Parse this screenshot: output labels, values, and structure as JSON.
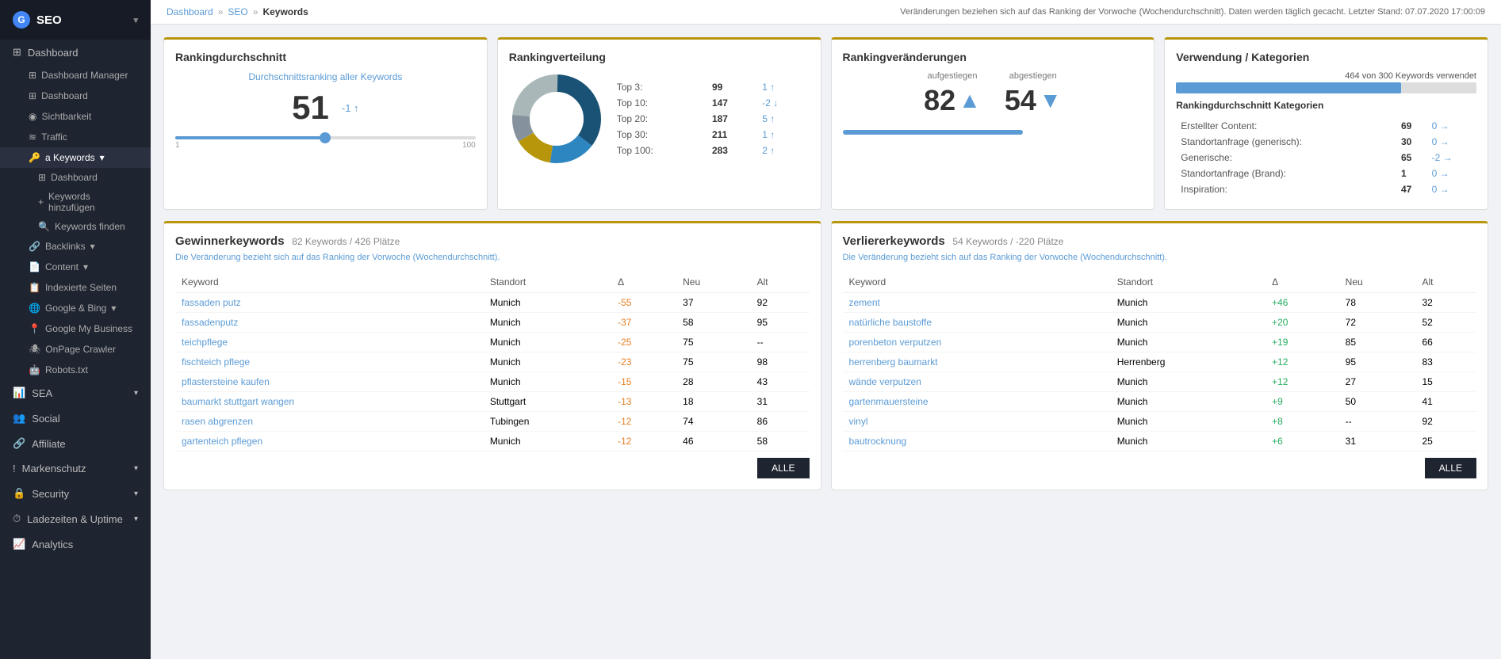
{
  "sidebar": {
    "logo_letter": "G",
    "app_name": "SEO",
    "items": [
      {
        "id": "dashboard",
        "label": "Dashboard",
        "icon": "⊞",
        "active": false,
        "indent": 1
      },
      {
        "id": "dashboard-manager",
        "label": "Dashboard Manager",
        "icon": "⊞",
        "active": false,
        "indent": 0
      },
      {
        "id": "dashboard2",
        "label": "Dashboard",
        "icon": "⊞",
        "active": false,
        "indent": 1
      },
      {
        "id": "sichtbarkeit",
        "label": "Sichtbarkeit",
        "icon": "👁",
        "active": false,
        "indent": 1
      },
      {
        "id": "traffic",
        "label": "Traffic",
        "icon": "~",
        "active": false,
        "indent": 1
      },
      {
        "id": "keywords",
        "label": "Keywords",
        "icon": "🔑",
        "active": true,
        "indent": 1,
        "hasArrow": true
      },
      {
        "id": "kw-dashboard",
        "label": "Dashboard",
        "icon": "⊞",
        "active": true,
        "indent": 2
      },
      {
        "id": "kw-hinzufuegen",
        "label": "Keywords hinzufügen",
        "icon": "+",
        "active": false,
        "indent": 3
      },
      {
        "id": "kw-finden",
        "label": "Keywords finden",
        "icon": "🔍",
        "active": false,
        "indent": 2
      },
      {
        "id": "backlinks",
        "label": "Backlinks",
        "icon": "🔗",
        "active": false,
        "indent": 1,
        "hasArrow": true
      },
      {
        "id": "content",
        "label": "Content",
        "icon": "📄",
        "active": false,
        "indent": 1,
        "hasArrow": true
      },
      {
        "id": "indexierte-seiten",
        "label": "Indexierte Seiten",
        "icon": "📋",
        "active": false,
        "indent": 1
      },
      {
        "id": "google-bing",
        "label": "Google & Bing",
        "icon": "🌐",
        "active": false,
        "indent": 1,
        "hasArrow": true
      },
      {
        "id": "google-my-business",
        "label": "Google My Business",
        "icon": "📍",
        "active": false,
        "indent": 1
      },
      {
        "id": "onpage-crawler",
        "label": "OnPage Crawler",
        "icon": "🕷",
        "active": false,
        "indent": 1
      },
      {
        "id": "robots",
        "label": "Robots.txt",
        "icon": "🤖",
        "active": false,
        "indent": 1
      },
      {
        "id": "sea",
        "label": "SEA",
        "icon": "📊",
        "active": false,
        "indent": 0,
        "hasArrow": true
      },
      {
        "id": "social",
        "label": "Social",
        "icon": "👥",
        "active": false,
        "indent": 0
      },
      {
        "id": "affiliate",
        "label": "Affiliate",
        "icon": "🔗",
        "active": false,
        "indent": 0
      },
      {
        "id": "markenschutz",
        "label": "Markenschutz",
        "icon": "!",
        "active": false,
        "indent": 0,
        "hasArrow": true
      },
      {
        "id": "security",
        "label": "Security",
        "icon": "🔒",
        "active": false,
        "indent": 0,
        "hasArrow": true
      },
      {
        "id": "ladezeiten",
        "label": "Ladezeiten & Uptime",
        "icon": "⏱",
        "active": false,
        "indent": 0,
        "hasArrow": true
      },
      {
        "id": "analytics",
        "label": "Analytics",
        "icon": "📈",
        "active": false,
        "indent": 0
      }
    ]
  },
  "topbar": {
    "breadcrumb": [
      "Dashboard",
      "SEO",
      "Keywords"
    ],
    "info": "Veränderungen beziehen sich auf das Ranking der Vorwoche (Wochendurchschnitt). Daten werden täglich gecacht. Letzter Stand: 07.07.2020 17:00:09"
  },
  "cards": {
    "rankingdurchschnitt": {
      "title": "Rankingdurchschnitt",
      "label": "Durchschnittsranking aller Keywords",
      "value": "51",
      "change": "-1",
      "change_arrow": "↑",
      "slider_min": "1",
      "slider_max": "100"
    },
    "rankingverteilung": {
      "title": "Rankingverteilung",
      "rows": [
        {
          "label": "Top 3:",
          "val": "99",
          "change": "1",
          "direction": "up"
        },
        {
          "label": "Top 10:",
          "val": "147",
          "change": "-2",
          "direction": "down"
        },
        {
          "label": "Top 20:",
          "val": "187",
          "change": "5",
          "direction": "up"
        },
        {
          "label": "Top 30:",
          "val": "211",
          "change": "1",
          "direction": "up"
        },
        {
          "label": "Top 100:",
          "val": "283",
          "change": "2",
          "direction": "up"
        }
      ],
      "donut": {
        "segments": [
          {
            "label": "Top 3",
            "color": "#1a5276",
            "pct": 35
          },
          {
            "label": "Top 10",
            "color": "#2e86c1",
            "pct": 17
          },
          {
            "label": "Top 20",
            "color": "#b8960c",
            "pct": 14
          },
          {
            "label": "Top 30",
            "color": "#85929e",
            "pct": 10
          },
          {
            "label": "Top 100",
            "color": "#aab7b8",
            "pct": 24
          }
        ]
      }
    },
    "rankingveraenderungen": {
      "title": "Rankingveränderungen",
      "aufgestiegen_label": "aufgestiegen",
      "abgestiegen_label": "abgestiegen",
      "aufgestiegen_val": "82",
      "abgestiegen_val": "54"
    },
    "verwendung": {
      "title": "Verwendung / Kategorien",
      "used": "464",
      "total": "300",
      "label": "von 300 Keywords verwendet",
      "bar_pct": 75,
      "subtitle": "Rankingdurchschnitt Kategorien",
      "rows": [
        {
          "name": "Erstellter Content:",
          "val": "69",
          "change": "0",
          "dir": "neutral"
        },
        {
          "name": "Standortanfrage (generisch):",
          "val": "30",
          "change": "0",
          "dir": "neutral"
        },
        {
          "name": "Generische:",
          "val": "65",
          "change": "-2",
          "dir": "neg"
        },
        {
          "name": "Standortanfrage (Brand):",
          "val": "1",
          "change": "0",
          "dir": "neutral"
        },
        {
          "name": "Inspiration:",
          "val": "47",
          "change": "0",
          "dir": "neutral"
        }
      ]
    }
  },
  "gewinnerkeywords": {
    "title": "Gewinnerkeywords",
    "subtitle": "82 Keywords / 426 Plätze",
    "note": "Die Veränderung bezieht sich auf das Ranking der Vorwoche (Wochendurchschnitt).",
    "columns": [
      "Keyword",
      "Standort",
      "Δ",
      "Neu",
      "Alt"
    ],
    "rows": [
      {
        "keyword": "fassaden putz",
        "standort": "Munich",
        "delta": "-55",
        "neu": "37",
        "alt": "92"
      },
      {
        "keyword": "fassadenputz",
        "standort": "Munich",
        "delta": "-37",
        "neu": "58",
        "alt": "95"
      },
      {
        "keyword": "teichpflege",
        "standort": "Munich",
        "delta": "-25",
        "neu": "75",
        "alt": "--"
      },
      {
        "keyword": "fischteich pflege",
        "standort": "Munich",
        "delta": "-23",
        "neu": "75",
        "alt": "98"
      },
      {
        "keyword": "pflastersteine kaufen",
        "standort": "Munich",
        "delta": "-15",
        "neu": "28",
        "alt": "43"
      },
      {
        "keyword": "baumarkt stuttgart wangen",
        "standort": "Stuttgart",
        "delta": "-13",
        "neu": "18",
        "alt": "31"
      },
      {
        "keyword": "rasen abgrenzen",
        "standort": "Tubingen",
        "delta": "-12",
        "neu": "74",
        "alt": "86"
      },
      {
        "keyword": "gartenteich pflegen",
        "standort": "Munich",
        "delta": "-12",
        "neu": "46",
        "alt": "58"
      }
    ],
    "alle_btn": "ALLE"
  },
  "verliererkeywords": {
    "title": "Verliererkeywords",
    "subtitle": "54 Keywords / -220 Plätze",
    "note": "Die Veränderung bezieht sich auf das Ranking der Vorwoche (Wochendurchschnitt).",
    "columns": [
      "Keyword",
      "Standort",
      "Δ",
      "Neu",
      "Alt"
    ],
    "rows": [
      {
        "keyword": "zement",
        "standort": "Munich",
        "delta": "+46",
        "neu": "78",
        "alt": "32"
      },
      {
        "keyword": "natürliche baustoffe",
        "standort": "Munich",
        "delta": "+20",
        "neu": "72",
        "alt": "52"
      },
      {
        "keyword": "porenbeton verputzen",
        "standort": "Munich",
        "delta": "+19",
        "neu": "85",
        "alt": "66"
      },
      {
        "keyword": "herrenberg baumarkt",
        "standort": "Herrenberg",
        "delta": "+12",
        "neu": "95",
        "alt": "83"
      },
      {
        "keyword": "wände verputzen",
        "standort": "Munich",
        "delta": "+12",
        "neu": "27",
        "alt": "15"
      },
      {
        "keyword": "gartenmauersteine",
        "standort": "Munich",
        "delta": "+9",
        "neu": "50",
        "alt": "41"
      },
      {
        "keyword": "vinyl",
        "standort": "Munich",
        "delta": "+8",
        "neu": "--",
        "alt": "92"
      },
      {
        "keyword": "bautrocknung",
        "standort": "Munich",
        "delta": "+6",
        "neu": "31",
        "alt": "25"
      }
    ],
    "alle_btn": "ALLE"
  }
}
